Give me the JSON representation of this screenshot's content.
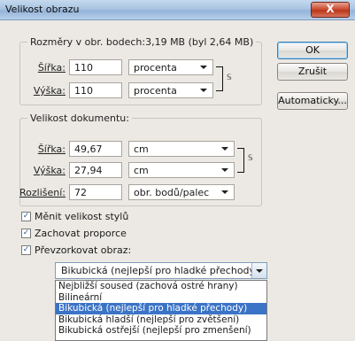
{
  "window": {
    "title": "Velikost obrazu",
    "close_label": "X"
  },
  "pixel_size": {
    "legend": "Rozměry v obr. bodech:3,19 MB (byl 2,64 MB)",
    "width_label": "Šířka:",
    "width_value": "110",
    "width_unit": "procenta",
    "height_label": "Výška:",
    "height_value": "110",
    "height_unit": "procenta"
  },
  "document_size": {
    "legend": "Velikost dokumentu:",
    "width_label": "Šířka:",
    "width_value": "49,67",
    "width_unit": "cm",
    "height_label": "Výška:",
    "height_value": "27,94",
    "height_unit": "cm",
    "resolution_label": "Rozlišení:",
    "resolution_value": "72",
    "resolution_unit": "obr. bodů/palec"
  },
  "buttons": {
    "ok": "OK",
    "cancel": "Zrušit",
    "auto": "Automaticky..."
  },
  "options": {
    "scale_styles": "Měnit velikost stylů",
    "constrain": "Zachovat proporce",
    "resample": "Převzorkovat obraz:",
    "scale_styles_checked": true,
    "constrain_checked": true,
    "resample_checked": true
  },
  "resample_method": {
    "selected": "Bikubická (nejlepší pro hladké přechody)",
    "list": [
      "Nejbližší soused (zachová ostré hrany)",
      "Bilineární",
      "Bikubická (nejlepší pro hladké přechody)",
      "Bikubická hladší (nejlepší pro zvětšení)",
      "Bikubická ostřejší (nejlepší pro zmenšení)"
    ],
    "highlighted_index": 2
  }
}
